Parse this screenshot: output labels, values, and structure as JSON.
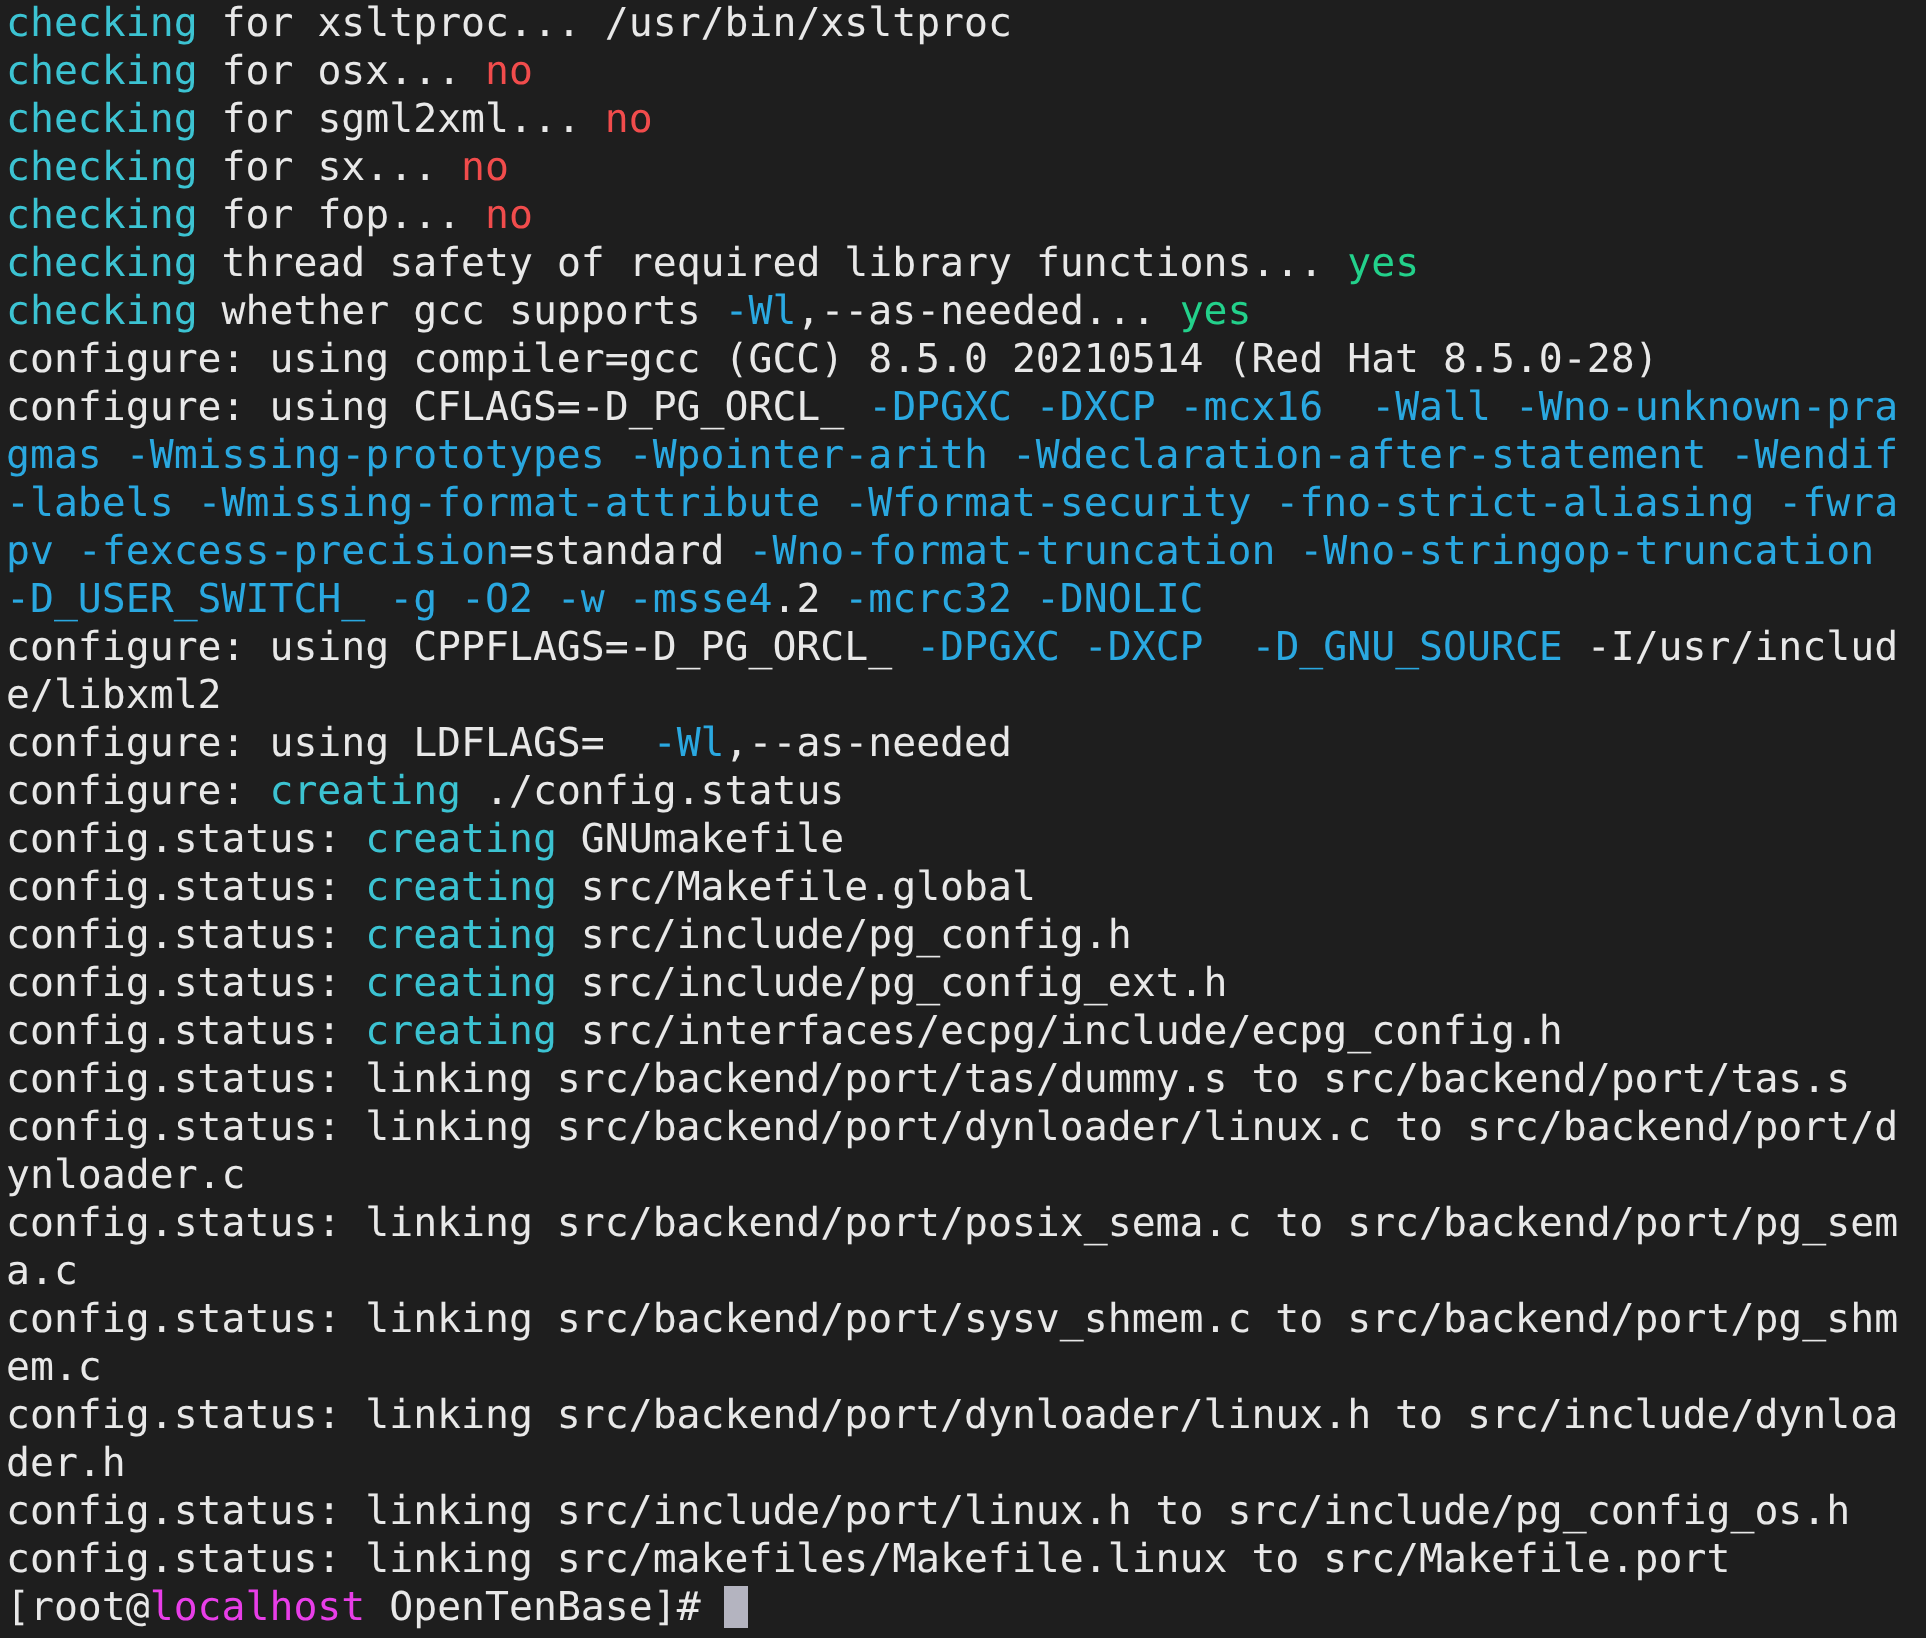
{
  "terminal": {
    "lines": [
      {
        "segments": [
          {
            "text": "checking",
            "kind": "keyword"
          },
          {
            "text": " for xsltproc... /usr/bin/xsltproc",
            "kind": "plain"
          }
        ]
      },
      {
        "segments": [
          {
            "text": "checking",
            "kind": "keyword"
          },
          {
            "text": " for osx... ",
            "kind": "plain"
          },
          {
            "text": "no",
            "kind": "no"
          }
        ]
      },
      {
        "segments": [
          {
            "text": "checking",
            "kind": "keyword"
          },
          {
            "text": " for sgml2xml... ",
            "kind": "plain"
          },
          {
            "text": "no",
            "kind": "no"
          }
        ]
      },
      {
        "segments": [
          {
            "text": "checking",
            "kind": "keyword"
          },
          {
            "text": " for sx... ",
            "kind": "plain"
          },
          {
            "text": "no",
            "kind": "no"
          }
        ]
      },
      {
        "segments": [
          {
            "text": "checking",
            "kind": "keyword"
          },
          {
            "text": " for fop... ",
            "kind": "plain"
          },
          {
            "text": "no",
            "kind": "no"
          }
        ]
      },
      {
        "segments": [
          {
            "text": "checking",
            "kind": "keyword"
          },
          {
            "text": " thread safety of required library functions... ",
            "kind": "plain"
          },
          {
            "text": "yes",
            "kind": "yes"
          }
        ]
      },
      {
        "segments": [
          {
            "text": "checking",
            "kind": "keyword"
          },
          {
            "text": " whether gcc supports ",
            "kind": "plain"
          },
          {
            "text": "-Wl",
            "kind": "flag"
          },
          {
            "text": ",--as-needed... ",
            "kind": "plain"
          },
          {
            "text": "yes",
            "kind": "yes"
          }
        ]
      },
      {
        "segments": [
          {
            "text": "configure: using compiler=gcc (GCC) 8.5.0 20210514 (Red Hat 8.5.0-28)",
            "kind": "plain"
          }
        ]
      },
      {
        "segments": [
          {
            "text": "configure: using CFLAGS=-D_PG_ORCL_ ",
            "kind": "plain"
          },
          {
            "text": "-DPGXC -DXCP -mcx16  -Wall -Wno-unknown-pragmas -Wmissing-prototypes -Wpointer-arith -Wdeclaration-after-statement -Wendif-labels -Wmissing-format-attribute -Wformat-security -fno-strict-aliasing -fwrapv -fexcess-precision",
            "kind": "flag"
          },
          {
            "text": "=standard ",
            "kind": "plain"
          },
          {
            "text": "-Wno-format-truncation -Wno-stringop-truncation -D_USER_SWITCH_ -g -O2 -w -msse4",
            "kind": "flag"
          },
          {
            "text": ".2 ",
            "kind": "plain"
          },
          {
            "text": "-mcrc32 -DNOLIC",
            "kind": "flag"
          }
        ]
      },
      {
        "segments": [
          {
            "text": "configure: using CPPFLAGS=-D_PG_ORCL_ ",
            "kind": "plain"
          },
          {
            "text": "-DPGXC -DXCP  -D_GNU_SOURCE",
            "kind": "flag"
          },
          {
            "text": " -I/usr/include/libxml2",
            "kind": "plain"
          }
        ]
      },
      {
        "segments": [
          {
            "text": "configure: using LDFLAGS=  ",
            "kind": "plain"
          },
          {
            "text": "-Wl",
            "kind": "flag"
          },
          {
            "text": ",--as-needed",
            "kind": "plain"
          }
        ]
      },
      {
        "segments": [
          {
            "text": "configure: ",
            "kind": "plain"
          },
          {
            "text": "creating",
            "kind": "keyword"
          },
          {
            "text": " ./config.status",
            "kind": "plain"
          }
        ]
      },
      {
        "segments": [
          {
            "text": "config.status: ",
            "kind": "plain"
          },
          {
            "text": "creating",
            "kind": "keyword"
          },
          {
            "text": " GNUmakefile",
            "kind": "plain"
          }
        ]
      },
      {
        "segments": [
          {
            "text": "config.status: ",
            "kind": "plain"
          },
          {
            "text": "creating",
            "kind": "keyword"
          },
          {
            "text": " src/Makefile.global",
            "kind": "plain"
          }
        ]
      },
      {
        "segments": [
          {
            "text": "config.status: ",
            "kind": "plain"
          },
          {
            "text": "creating",
            "kind": "keyword"
          },
          {
            "text": " src/include/pg_config.h",
            "kind": "plain"
          }
        ]
      },
      {
        "segments": [
          {
            "text": "config.status: ",
            "kind": "plain"
          },
          {
            "text": "creating",
            "kind": "keyword"
          },
          {
            "text": " src/include/pg_config_ext.h",
            "kind": "plain"
          }
        ]
      },
      {
        "segments": [
          {
            "text": "config.status: ",
            "kind": "plain"
          },
          {
            "text": "creating",
            "kind": "keyword"
          },
          {
            "text": " src/interfaces/ecpg/include/ecpg_config.h",
            "kind": "plain"
          }
        ]
      },
      {
        "segments": [
          {
            "text": "config.status: linking src/backend/port/tas/dummy.s to src/backend/port/tas.s",
            "kind": "plain"
          }
        ]
      },
      {
        "segments": [
          {
            "text": "config.status: linking src/backend/port/dynloader/linux.c to src/backend/port/dynloader.c",
            "kind": "plain"
          }
        ]
      },
      {
        "segments": [
          {
            "text": "config.status: linking src/backend/port/posix_sema.c to src/backend/port/pg_sema.c",
            "kind": "plain"
          }
        ]
      },
      {
        "segments": [
          {
            "text": "config.status: linking src/backend/port/sysv_shmem.c to src/backend/port/pg_shmem.c",
            "kind": "plain"
          }
        ]
      },
      {
        "segments": [
          {
            "text": "config.status: linking src/backend/port/dynloader/linux.h to src/include/dynloader.h",
            "kind": "plain"
          }
        ]
      },
      {
        "segments": [
          {
            "text": "config.status: linking src/include/port/linux.h to src/include/pg_config_os.h",
            "kind": "plain"
          }
        ]
      },
      {
        "segments": [
          {
            "text": "config.status: linking src/makefiles/Makefile.linux to src/Makefile.port",
            "kind": "plain"
          }
        ]
      }
    ],
    "prompt": {
      "segments": [
        {
          "text": "[root@",
          "kind": "plain"
        },
        {
          "text": "localhost",
          "kind": "host"
        },
        {
          "text": " OpenTenBase]# ",
          "kind": "plain"
        }
      ],
      "cursor_visible": true
    }
  }
}
